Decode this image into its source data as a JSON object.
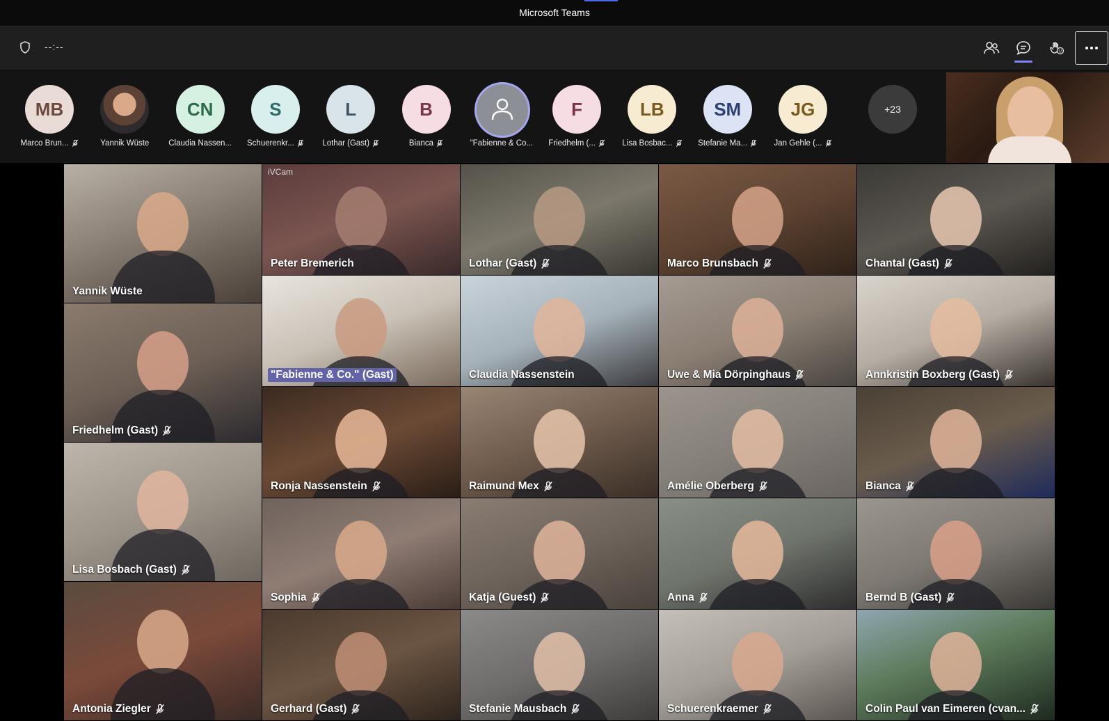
{
  "app": {
    "title": "Microsoft Teams",
    "accent_color": "#4f6bed"
  },
  "toolbar": {
    "timer": "--:--",
    "buttons": [
      {
        "name": "participants-button",
        "icon": "people-icon"
      },
      {
        "name": "chat-button",
        "icon": "chat-icon",
        "active": true
      },
      {
        "name": "reactions-button",
        "icon": "reaction-icon"
      },
      {
        "name": "more-actions-button",
        "icon": "ellipsis-icon"
      }
    ]
  },
  "roster": {
    "people": [
      {
        "initials": "MB",
        "label": "Marco Brun...",
        "bg": "#e9dcd6",
        "fg": "#6b4a3e",
        "muted": true
      },
      {
        "initials": "",
        "label": "Yannik Wüste",
        "bg": "#6b5446",
        "fg": "#ffffff",
        "muted": false,
        "photo": true
      },
      {
        "initials": "CN",
        "label": "Claudia Nassen...",
        "bg": "#d6f0e1",
        "fg": "#2d6b48",
        "muted": false
      },
      {
        "initials": "S",
        "label": "Schuerenkr...",
        "bg": "#d8efee",
        "fg": "#2c6b69",
        "muted": true
      },
      {
        "initials": "L",
        "label": "Lothar (Gast)",
        "bg": "#d9e3ea",
        "fg": "#3e5566",
        "muted": true
      },
      {
        "initials": "B",
        "label": "Bianca",
        "bg": "#f6dde3",
        "fg": "#7a3447",
        "muted": true
      },
      {
        "initials": "",
        "label": "\"Fabienne & Co...",
        "bg": "#8c8f95",
        "fg": "#ffffff",
        "muted": false,
        "generic": true
      },
      {
        "initials": "F",
        "label": "Friedhelm (...",
        "bg": "#f6dde3",
        "fg": "#7a3447",
        "muted": true
      },
      {
        "initials": "LB",
        "label": "Lisa Bosbac...",
        "bg": "#f7ecd2",
        "fg": "#7a5a1e",
        "muted": true
      },
      {
        "initials": "SM",
        "label": "Stefanie Ma...",
        "bg": "#dce3f4",
        "fg": "#2e3f73",
        "muted": true
      },
      {
        "initials": "JG",
        "label": "Jan Gehle (...",
        "bg": "#f7ecd2",
        "fg": "#7a5a1e",
        "muted": true
      }
    ],
    "overflow_count": "+23"
  },
  "gallery": {
    "tiles": [
      {
        "name": "Yannik Wüste",
        "muted": false,
        "bg": "linear-gradient(160deg,#b8b0a6,#8f857a 40%,#4b4038)",
        "face": "#d9a98a"
      },
      {
        "name": "Friedhelm (Gast)",
        "muted": true,
        "bg": "linear-gradient(160deg,#8a7b6d,#6d5f55 50%,#2c2a2e)",
        "face": "#d7a08a"
      },
      {
        "name": "Lisa Bosbach (Gast)",
        "muted": true,
        "bg": "linear-gradient(160deg,#bdb6ac,#9d958a 50%,#6e675f)",
        "face": "#e0b59d"
      },
      {
        "name": "Antonia Ziegler",
        "muted": true,
        "bg": "linear-gradient(160deg,#5a4b3f,#7a4a3a 50%,#3a2a26)",
        "face": "#d9a98a"
      },
      {
        "name": "Peter Bremerich",
        "muted": false,
        "bg": "linear-gradient(160deg,#5b3c3c,#7b5550 50%,#3a2a2a)",
        "face": "#a57d70",
        "tag": "iVCam"
      },
      {
        "name": "\"Fabienne & Co.\" (Gast)",
        "muted": false,
        "highlight": true,
        "bg": "linear-gradient(160deg,#e8e4de,#c9c1b6 50%,#7a6a5c)",
        "face": "#c99a80"
      },
      {
        "name": "Ronja Nassenstein",
        "muted": true,
        "bg": "linear-gradient(160deg,#3b2a20,#6b4a35 50%,#2a1d16)",
        "face": "#e8b998"
      },
      {
        "name": "Sophia",
        "muted": true,
        "bg": "linear-gradient(160deg,#6e625b,#8f7d74 50%,#4a3b35)",
        "face": "#d9a98a"
      },
      {
        "name": "Gerhard (Gast)",
        "muted": true,
        "bg": "linear-gradient(160deg,#4a3a2e,#6b5442 50%,#2e241c)",
        "face": "#c08e76"
      },
      {
        "name": "Lothar (Gast)",
        "muted": true,
        "bg": "linear-gradient(160deg,#55524a,#7c786c 50%,#3a3832)",
        "face": "#b79a82"
      },
      {
        "name": "Claudia Nassenstein",
        "muted": false,
        "bg": "linear-gradient(160deg,#c9d3da,#a6b2ba 50%,#3b3b3e)",
        "face": "#e2b59a"
      },
      {
        "name": "Raimund Mex",
        "muted": true,
        "bg": "linear-gradient(160deg,#9a8574,#6e5b4c 50%,#3a2e26)",
        "face": "#e6c4aa"
      },
      {
        "name": "Katja (Guest)",
        "muted": true,
        "bg": "linear-gradient(160deg,#8a7d72,#6e645c 50%,#4a413b)",
        "face": "#e0b49a"
      },
      {
        "name": "Stefanie Mausbach",
        "muted": true,
        "bg": "linear-gradient(160deg,#8c8a88,#6f6d6b 50%,#3e3c3a)",
        "face": "#e2c0a8"
      },
      {
        "name": "Marco Brunsbach",
        "muted": true,
        "bg": "linear-gradient(160deg,#7a5a44,#5e4332 50%,#2f2219)",
        "face": "#d5a388"
      },
      {
        "name": "Uwe & Mia Dörpinghaus",
        "muted": true,
        "bg": "linear-gradient(160deg,#a59b92,#8b7f74 50%,#4a4540)",
        "face": "#deb199"
      },
      {
        "name": "Amélie Oberberg",
        "muted": true,
        "bg": "linear-gradient(160deg,#9b948c,#85807a 50%,#6a6560)",
        "face": "#e3bca2"
      },
      {
        "name": "Anna",
        "muted": true,
        "bg": "linear-gradient(160deg,#8a8f86,#6f746c 50%,#2e2e2e)",
        "face": "#e6b89b"
      },
      {
        "name": "Schuerenkraemer",
        "muted": true,
        "bg": "linear-gradient(160deg,#c4bfb8,#a39e97 50%,#5a5550)",
        "face": "#d9a88e"
      },
      {
        "name": "Chantal (Gast)",
        "muted": true,
        "bg": "linear-gradient(160deg,#3c3a36,#5a5650 50%,#23211e)",
        "face": "#e9c8b0"
      },
      {
        "name": "Annkristin Boxberg (Gast)",
        "muted": true,
        "bg": "linear-gradient(160deg,#d9d4cc,#b5ada3 50%,#3a3430)",
        "face": "#e5bc9f"
      },
      {
        "name": "Bianca",
        "muted": true,
        "bg": "linear-gradient(160deg,#4a4035,#6a5c4c 50%,#1e2a5a)",
        "face": "#e0b49a"
      },
      {
        "name": "Bernd B (Gast)",
        "muted": true,
        "bg": "linear-gradient(160deg,#9a958f,#7e7973 50%,#3a3835)",
        "face": "#d9a088"
      },
      {
        "name": "Colin Paul van Eimeren (cvan...",
        "muted": true,
        "bg": "linear-gradient(160deg,#8fa6b0,#5c7a5a 45%,#1e2a20)",
        "face": "#dfb39a"
      }
    ]
  }
}
